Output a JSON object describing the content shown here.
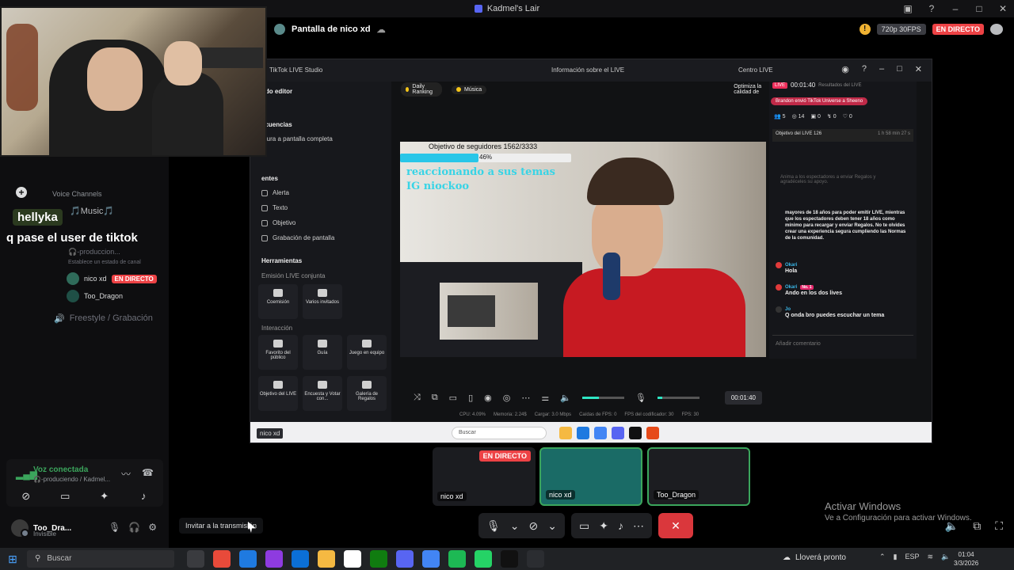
{
  "window": {
    "title": "Kadmel's Lair"
  },
  "sidebar": {
    "voice_channels_label": "Voice Channels",
    "music_channel": "🎵Music🎵",
    "overlay_chat": {
      "username": "hellyka",
      "message": "q pase el user de tiktok"
    },
    "sub_channel": "🎧-produccion...",
    "channel_status": "Establece un estado de canal",
    "members": [
      {
        "name": "nico xd",
        "badge": "EN DIRECTO"
      },
      {
        "name": "Too_Dragon",
        "badge": ""
      }
    ],
    "freestyle_channel": "Freestyle / Grabación"
  },
  "voice_connected": {
    "status": "Voz conectada",
    "channel": "🎧-produciendo / Kadmel..."
  },
  "user_panel": {
    "name": "Too_Dra...",
    "status": "Invisible"
  },
  "tooltip": "Invitar a la transmisión",
  "stream": {
    "title": "Pantalla de nico xd",
    "quality": "720p 30FPS",
    "live_tag": "EN DIRECTO"
  },
  "tiktok": {
    "app_name": "TikTok LIVE Studio",
    "info_title": "Información sobre el LIVE",
    "center_live": "Centro LIVE",
    "mode": "odo editor",
    "scenes_section": "ecuencias",
    "capture_item": "ptura a pantalla completa",
    "sources_section": "entes",
    "sources": [
      "Alerta",
      "Texto",
      "Objetivo",
      "Grabación de pantalla"
    ],
    "tools_section": "Herramientas",
    "joint_live": "Emisión LIVE conjunta",
    "tools_row1": [
      "Coemisión",
      "Varios invitados"
    ],
    "interaction": "Interacción",
    "tools_row2": [
      "Favorito del público",
      "Guía",
      "Juego en equipo"
    ],
    "tools_row3": [
      "Objetivo del LIVE",
      "Encuesta y Votar con...",
      "Galería de Regalos"
    ],
    "tabs": [
      "Daily Ranking",
      "Música"
    ],
    "optimize": "Optimiza la calidad de",
    "goal_label": "Objetivo de seguidores 1562/3333",
    "goal_percent": "46%",
    "goal_fraction": 0.46,
    "caption_line1": "reaccionando a sus temas",
    "caption_line2": "IG niockoo",
    "timer": "00:01:40",
    "stats": [
      "CPU: 4.09%",
      "Memoria: 2.24$",
      "Cargar: 3.0 Mbps",
      "Caídas de FPS: 0",
      "FPS del codificador: 30",
      "FPS: 30"
    ],
    "live_timer": "00:01:40",
    "chat_header": "Resultados del LIVE",
    "gift_banner": "Brandon envió TikTok Universe a Sheeno",
    "counts": [
      "5",
      "14",
      "0",
      "0",
      "0"
    ],
    "objective": "Objetivo del LIVE 126",
    "objective_time": "1 h 58 min 27 s",
    "dim_text": "Anima a los espectadores a enviar Regalos y agradéceles su apoyo.",
    "rules": "mayores de 18 años para poder emitir LIVE, mientras que los espectadores deben tener 18 años como mínimo para recargar y enviar Regalos. No te olvides crear una experiencia segura cumpliendo las Normas de la comunidad.",
    "messages": [
      {
        "user": "Okari",
        "text": "Hola",
        "badge": ""
      },
      {
        "user": "Okari",
        "text": "Ando en los dos lives",
        "badge": "No. 1"
      },
      {
        "user": "Jo",
        "text": "Q onda bro puedes escuchar un tema",
        "badge": ""
      }
    ],
    "chat_placeholder": "Añadir comentario",
    "win_label": "nico xd",
    "win_search": "Buscar"
  },
  "tiles": [
    {
      "name": "nico xd",
      "badge": "EN DIRECTO"
    },
    {
      "name": "nico xd",
      "badge": ""
    },
    {
      "name": "Too_Dragon",
      "badge": ""
    }
  ],
  "activate_windows": {
    "title": "Activar Windows",
    "subtitle": "Ve a Configuración para activar Windows."
  },
  "taskbar": {
    "search_placeholder": "Buscar",
    "weather": "Lloverá pronto",
    "lang": "ESP",
    "time": "01:04",
    "date": "3/3/2026"
  },
  "colors": {
    "accent": "#3ba55c",
    "live": "#ed4245",
    "hangup": "#da373c"
  }
}
